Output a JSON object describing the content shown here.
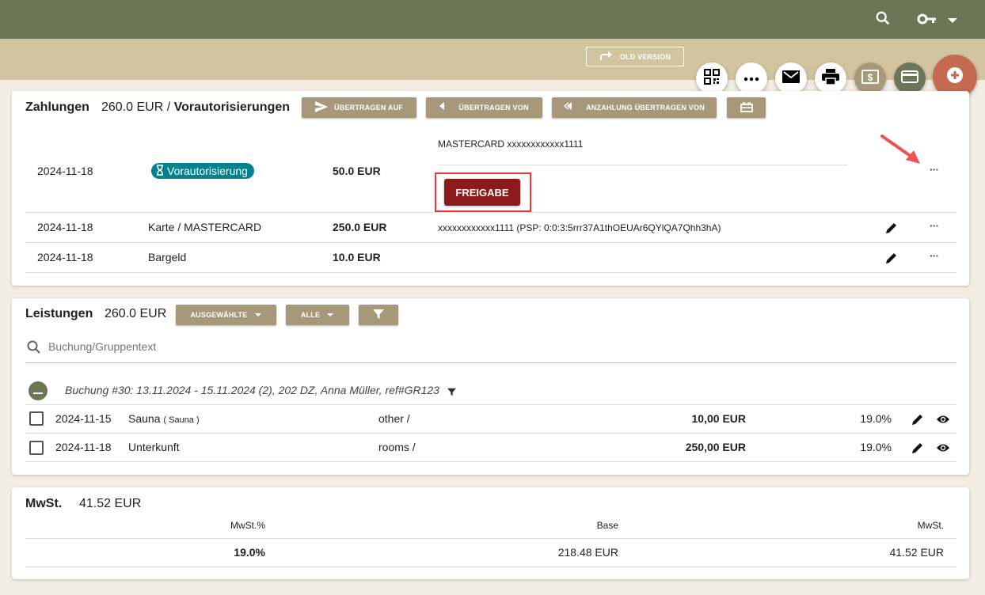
{
  "header": {
    "old_version_label": "OLD VERSION"
  },
  "payments": {
    "title": "Zahlungen",
    "amount": "260.0 EUR",
    "separator": "/",
    "subtitle": "Vorautorisierungen",
    "buttons": [
      "ÜBERTRAGEN AUF",
      "ÜBERTRAGEN VON",
      "ANZAHLUNG ÜBERTRAGEN VON"
    ],
    "rows": [
      {
        "date": "2024-11-18",
        "type": "Vorautorisierung",
        "amount": "50.0 EUR",
        "detail": "MASTERCARD xxxxxxxxxxxx1111",
        "action": "FREIGABE"
      },
      {
        "date": "2024-11-18",
        "type": "Karte / MASTERCARD",
        "amount": "250.0 EUR",
        "detail": "xxxxxxxxxxxx1111 (PSP: 0:0:3:5rrr37A1thOEUAr6QYlQA7Qhh3hA)"
      },
      {
        "date": "2024-11-18",
        "type": "Bargeld",
        "amount": "10.0 EUR",
        "detail": ""
      }
    ]
  },
  "services": {
    "title": "Leistungen",
    "amount": "260.0 EUR",
    "selected_label": "AUSGEWÄHLTE",
    "all_label": "ALLE",
    "search_placeholder": "Buchung/Gruppentext",
    "booking_label": "Buchung #30: 13.11.2024 - 15.11.2024 (2), 202 DZ, Anna Müller, ref#GR123",
    "items": [
      {
        "date": "2024-11-15",
        "name": "Sauna",
        "sub": "( Sauna )",
        "category": "other /",
        "price": "10,00 EUR",
        "vat": "19.0%"
      },
      {
        "date": "2024-11-18",
        "name": "Unterkunft",
        "sub": "",
        "category": "rooms /",
        "price": "250,00 EUR",
        "vat": "19.0%"
      }
    ]
  },
  "vat": {
    "title": "MwSt.",
    "amount": "41.52 EUR",
    "columns": [
      "MwSt.%",
      "Base",
      "MwSt."
    ],
    "row": {
      "rate": "19.0%",
      "base": "218.48 EUR",
      "tax": "41.52 EUR"
    }
  },
  "colors": {
    "topbar": "#6b7657",
    "accent_tan": "#a8987a",
    "freigabe": "#8b1a1a",
    "badge": "#00838f",
    "fab_primary": "#c36a50"
  }
}
